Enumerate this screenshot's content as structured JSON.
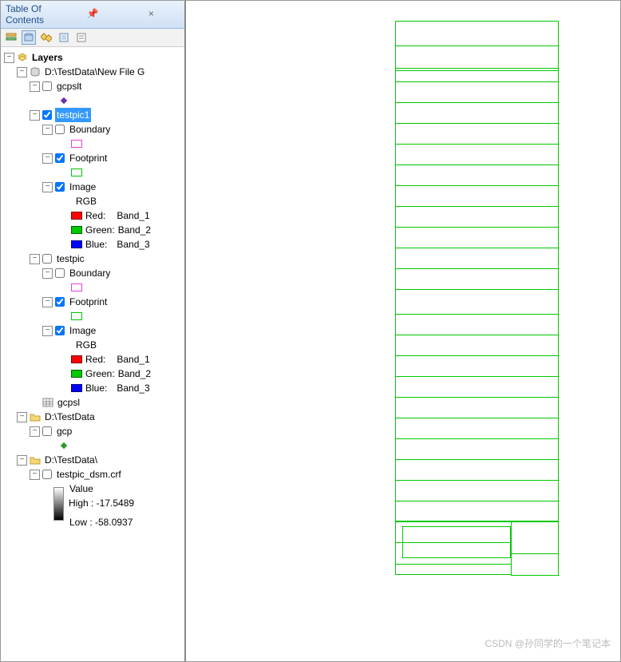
{
  "panel": {
    "title": "Table Of Contents"
  },
  "root": {
    "label": "Layers"
  },
  "ds1": {
    "label": "D:\\TestData\\New File G"
  },
  "gcpslt": {
    "label": "gcpslt"
  },
  "tp1": {
    "label": "testpic1",
    "boundary": "Boundary",
    "footprint": "Footprint",
    "image": "Image",
    "rgb": "RGB",
    "red": "Red:",
    "green": "Green:",
    "blue": "Blue:",
    "b1": "Band_1",
    "b2": "Band_2",
    "b3": "Band_3"
  },
  "tp": {
    "label": "testpic",
    "boundary": "Boundary",
    "footprint": "Footprint",
    "image": "Image",
    "rgb": "RGB",
    "red": "Red:",
    "green": "Green:",
    "blue": "Blue:",
    "b1": "Band_1",
    "b2": "Band_2",
    "b3": "Band_3"
  },
  "gcpsl": {
    "label": "gcpsl"
  },
  "ds2": {
    "label": "D:\\TestData"
  },
  "gcp": {
    "label": "gcp"
  },
  "ds3": {
    "label": "D:\\TestData\\"
  },
  "dsm": {
    "label": "testpic_dsm.crf",
    "value": "Value",
    "high": "High : -17.5489",
    "low": "Low : -58.0937"
  },
  "watermark": "CSDN @孙同学的一个笔记本"
}
